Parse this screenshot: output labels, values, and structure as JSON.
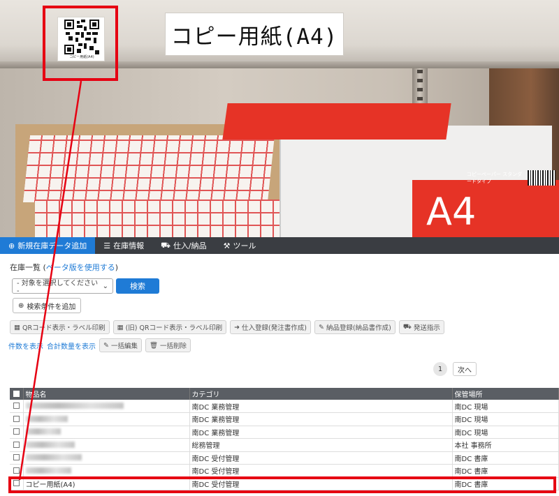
{
  "photo": {
    "shelf_label": "コピー用紙(A4)",
    "qr_caption": "コピー用紙(A4)",
    "case_text": "A4",
    "case_subtext": "コピーペーパー スタンダードタイプ",
    "accent_red": "#e60012"
  },
  "navbar": {
    "items": [
      {
        "label": "新規在庫データ追加",
        "icon": "plus-circle-icon"
      },
      {
        "label": "在庫情報",
        "icon": "list-icon"
      },
      {
        "label": "仕入/納品",
        "icon": "truck-icon"
      },
      {
        "label": "ツール",
        "icon": "tools-icon"
      }
    ],
    "active_color": "#1f7bd6"
  },
  "list": {
    "title_prefix": "在庫一覧 (",
    "beta_link": "ベータ版を使用する",
    "title_suffix": ")",
    "select_placeholder": "- 対象を選択してください -",
    "search_label": "検索",
    "add_condition_label": "検索条件を追加"
  },
  "actions": [
    {
      "label": "QRコード表示・ラベル印刷",
      "icon": "qr-icon"
    },
    {
      "label": "(旧) QRコード表示・ラベル印刷",
      "icon": "qr-icon"
    },
    {
      "label": "仕入登録(発注書作成)",
      "icon": "sign-in-icon"
    },
    {
      "label": "納品登録(納品書作成)",
      "icon": "edit-icon"
    },
    {
      "label": "発送指示",
      "icon": "truck-icon"
    }
  ],
  "row2": {
    "show_count_link": "件数を表示",
    "show_total_link": "合計数量を表示",
    "bulk_edit_label": "一括編集",
    "bulk_delete_label": "一括削除"
  },
  "pager": {
    "current": "1",
    "next_label": "次へ"
  },
  "table": {
    "headers": [
      "物品名",
      "カテゴリ",
      "保管場所"
    ],
    "rows": [
      {
        "name": "",
        "category": "南DC 業務管理",
        "location": "南DC 現場"
      },
      {
        "name": "",
        "category": "南DC 業務管理",
        "location": "南DC 現場"
      },
      {
        "name": "",
        "category": "南DC 業務管理",
        "location": "南DC 現場"
      },
      {
        "name": "",
        "category": "総務管理",
        "location": "本社 事務所"
      },
      {
        "name": "",
        "category": "南DC 受付管理",
        "location": "南DC 書庫"
      },
      {
        "name": "",
        "category": "南DC 受付管理",
        "location": "南DC 書庫"
      },
      {
        "name": "コピー用紙(A4)",
        "category": "南DC 受付管理",
        "location": "南DC 書庫"
      }
    ]
  }
}
